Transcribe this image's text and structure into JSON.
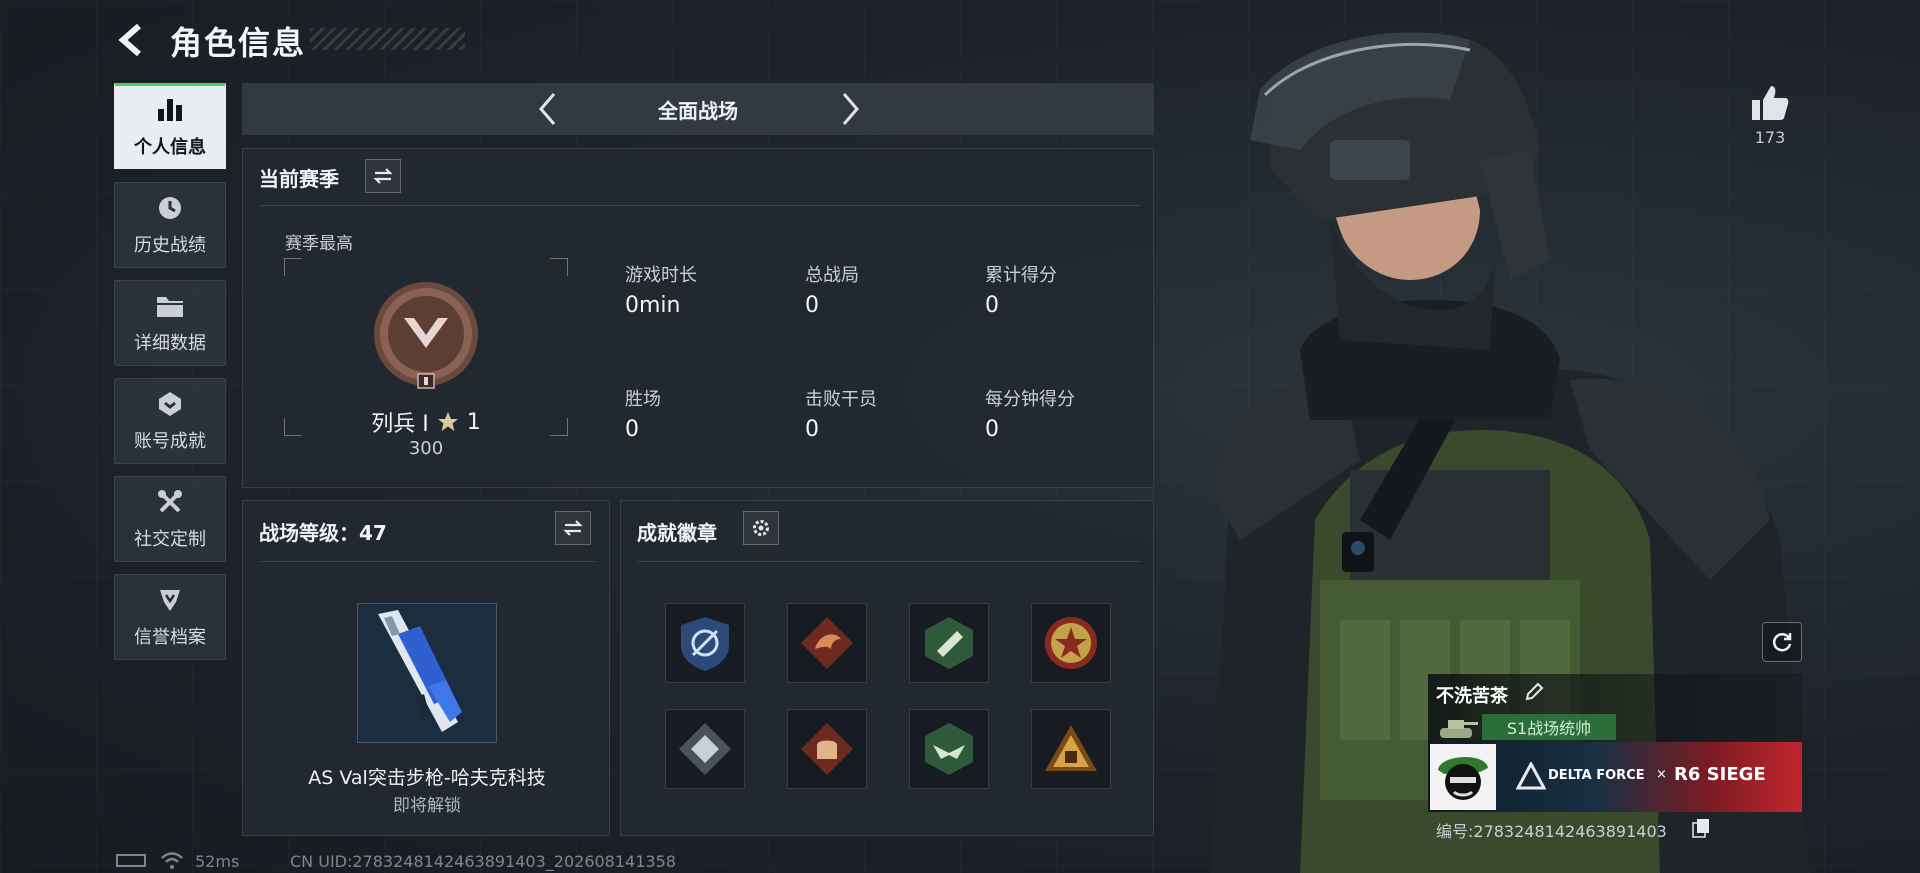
{
  "header": {
    "title": "角色信息"
  },
  "sidebar": {
    "items": [
      {
        "label": "个人信息",
        "icon": "bar-chart-icon",
        "active": true
      },
      {
        "label": "历史战绩",
        "icon": "clock-icon",
        "active": false
      },
      {
        "label": "详细数据",
        "icon": "folder-icon",
        "active": false
      },
      {
        "label": "账号成就",
        "icon": "badge-icon",
        "active": false
      },
      {
        "label": "社交定制",
        "icon": "tools-icon",
        "active": false
      },
      {
        "label": "信誉档案",
        "icon": "shield-icon",
        "active": false
      }
    ]
  },
  "mode": {
    "label": "全面战场"
  },
  "season": {
    "heading": "当前赛季",
    "best_label": "赛季最高",
    "rank_name": "列兵 Ⅰ",
    "rank_stars": "1",
    "rank_points": "300",
    "stats": [
      {
        "label": "游戏时长",
        "value": "0min"
      },
      {
        "label": "总战局",
        "value": "0"
      },
      {
        "label": "累计得分",
        "value": "0"
      },
      {
        "label": "胜场",
        "value": "0"
      },
      {
        "label": "击败干员",
        "value": "0"
      },
      {
        "label": "每分钟得分",
        "value": "0"
      }
    ]
  },
  "battle_level": {
    "heading": "战场等级：47",
    "weapon_name": "AS Val突击步枪-哈夫克科技",
    "unlock_text": "即将解锁"
  },
  "badges": {
    "heading": "成就徽章",
    "items": [
      {
        "icon": "shield-crest-icon",
        "color": "#3a6aa8"
      },
      {
        "icon": "dragon-icon",
        "color": "#a2452f"
      },
      {
        "icon": "hexagon-emblem-icon",
        "color": "#4a8a5c"
      },
      {
        "icon": "star-medal-icon",
        "color": "#b83a2a"
      },
      {
        "icon": "diamond-crest-icon",
        "color": "#8a939c"
      },
      {
        "icon": "fist-icon",
        "color": "#a2452f"
      },
      {
        "icon": "eagle-hexagon-icon",
        "color": "#4a8a5c"
      },
      {
        "icon": "triangle-emblem-icon",
        "color": "#c28a2a"
      }
    ]
  },
  "footer": {
    "ping": "52ms",
    "uid": "CN UID:2783248142463891403_202608141358"
  },
  "likes": {
    "count": "173"
  },
  "player": {
    "name": "不洗苦茶",
    "title": "S1战场统帅",
    "banner_left": "DELTA FORCE",
    "banner_x": "×",
    "banner_right": "R6 SIEGE",
    "id_text": "编号:2783248142463891403"
  },
  "colors": {
    "accent_green": "#45d16a",
    "panel": "#222930",
    "background": "#1c2228"
  }
}
